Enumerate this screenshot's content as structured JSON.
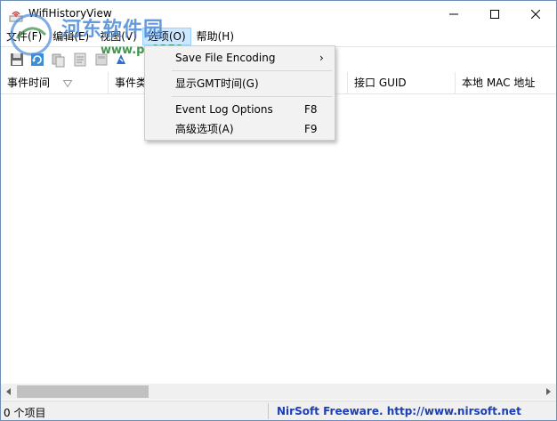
{
  "window": {
    "title": "WifiHistoryView",
    "minimize_icon": "minimize-icon",
    "maximize_icon": "maximize-icon",
    "close_icon": "close-icon"
  },
  "watermark": {
    "text": "河东软件园",
    "url": "www.pc0359.cn"
  },
  "menubar": {
    "items": [
      {
        "label": "文件(F)"
      },
      {
        "label": "编辑(E)"
      },
      {
        "label": "视图(V)"
      },
      {
        "label": "选项(O)",
        "active": true
      },
      {
        "label": "帮助(H)"
      }
    ]
  },
  "toolbar": {
    "icons": [
      "save-icon",
      "refresh-icon",
      "copy-icon",
      "properties-icon",
      "html-report-icon",
      "about-icon"
    ]
  },
  "columns": [
    {
      "label": "事件时间"
    },
    {
      "label": "事件类"
    },
    {
      "label": ""
    },
    {
      "label": "接口 GUID"
    },
    {
      "label": "本地 MAC 地址"
    }
  ],
  "options_menu": {
    "items": [
      {
        "label": "Save File Encoding",
        "shortcut": "",
        "submenu": true
      },
      {
        "label": "显示GMT时间(G)",
        "shortcut": ""
      },
      {
        "label": "Event Log Options",
        "shortcut": "F8"
      },
      {
        "label": "高级选项(A)",
        "shortcut": "F9"
      }
    ],
    "submenu_arrow": "›"
  },
  "status": {
    "count": "0 个项目",
    "link": "NirSoft Freeware.  http://www.nirsoft.net"
  },
  "colors": {
    "menu_active_bg": "#cce8ff",
    "link": "#1a3fb8",
    "watermark_blue": "#4a8ad8",
    "watermark_green": "#2e8b3a"
  }
}
